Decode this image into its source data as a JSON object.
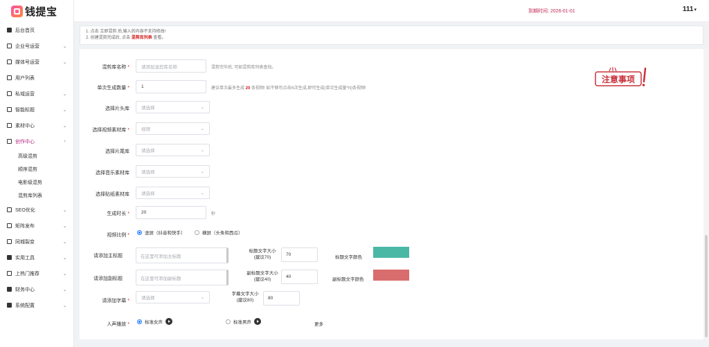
{
  "brand": {
    "name": "钱提宝"
  },
  "header": {
    "expire_label": "到期时间: 2026-01-01",
    "user": "111",
    "user_caret": "▾"
  },
  "sidebar": {
    "items": [
      {
        "label": "后台首页",
        "icon": "grid-icon",
        "chevron": ""
      },
      {
        "label": "企业号运营",
        "icon": "box-icon",
        "chevron": "⌄"
      },
      {
        "label": "媒体号运营",
        "icon": "box-icon",
        "chevron": "⌄"
      },
      {
        "label": "用户列表",
        "icon": "user-icon",
        "chevron": ""
      },
      {
        "label": "私域运营",
        "icon": "chat-icon",
        "chevron": "⌄"
      },
      {
        "label": "智能标题",
        "icon": "list-icon",
        "chevron": "⌄"
      },
      {
        "label": "素材中心",
        "icon": "image-icon",
        "chevron": "⌄"
      },
      {
        "label": "创作中心",
        "icon": "gear-icon",
        "chevron": "‹"
      }
    ],
    "sub_items": [
      {
        "label": "高级混剪"
      },
      {
        "label": "顺序混剪"
      },
      {
        "label": "电影级混剪"
      },
      {
        "label": "混剪库列表"
      }
    ],
    "items2": [
      {
        "label": "SEO优化",
        "icon": "seo-icon",
        "chevron": "⌄"
      },
      {
        "label": "矩阵发布",
        "icon": "video-icon",
        "chevron": "⌄"
      },
      {
        "label": "同城裂变",
        "icon": "link-icon",
        "chevron": "⌄"
      },
      {
        "label": "实用工具",
        "icon": "tool-icon",
        "chevron": "⌄"
      },
      {
        "label": "上热门推荐",
        "icon": "fire-icon",
        "chevron": "⌄"
      },
      {
        "label": "财务中心",
        "icon": "wallet-icon",
        "chevron": "⌄"
      },
      {
        "label": "系统配置",
        "icon": "settings-icon",
        "chevron": "⌄"
      }
    ]
  },
  "notice": {
    "line1": "1. 点击 立即混剪 后,输入的内容不支持修改!",
    "line2_pre": "2. 创建混剪完成后, 点击 ",
    "line2_link": "混剪库列表",
    "line2_post": " 查看。"
  },
  "form": {
    "lib_name": {
      "label": "混剪库名称",
      "placeholder": "请添加混剪库名称",
      "hint": "混剪完毕后, 可如混剪库列表查找。"
    },
    "gen_count": {
      "label": "单次生成数量",
      "value": "1",
      "hint_pre": "建议单次最多生成 ",
      "hint_num": "20",
      "hint_post": " 条视频! 如不够可点击N次生成,即可生成(单次生成量*N)条视频!"
    },
    "intro": {
      "label": "选择片头库",
      "placeholder": "请选择"
    },
    "video_lib": {
      "label": "选择视频素材库",
      "placeholder": "视频"
    },
    "outro": {
      "label": "选择片尾库",
      "placeholder": "请选择"
    },
    "music": {
      "label": "选择音乐素材库",
      "placeholder": "请选择"
    },
    "sticker": {
      "label": "选择贴纸素材库",
      "placeholder": "请选择"
    },
    "duration": {
      "label": "生成时长",
      "value": "20",
      "unit": "秒"
    },
    "ratio": {
      "label": "视频比例",
      "opt1": "竖屏（抖音和快手）",
      "opt2": "横屏（头条和西瓜）"
    },
    "main_title": {
      "label": "请添加主标题",
      "placeholder": "在这里可添加主标题",
      "size_label": "标题文字大小\n(建议70)",
      "size_value": "70",
      "color_label": "标题文字颜色",
      "color": "#4bb8a6"
    },
    "sub_title": {
      "label": "请添加副标题",
      "placeholder": "在这里可添加副标题",
      "size_label": "副标题文字大小\n(建议40)",
      "size_value": "40",
      "color_label": "副标题文字颜色",
      "color": "#d96c6c"
    },
    "subtitle": {
      "label": "请添加字幕",
      "placeholder": "请选择",
      "size_label": "字幕文字大小\n(建议80)",
      "size_value": "80"
    },
    "voice": {
      "label": "人声播放",
      "opt1": "标准女声",
      "opt2": "标准男声",
      "more": "更多"
    }
  },
  "badge": {
    "text": "注意事项"
  }
}
